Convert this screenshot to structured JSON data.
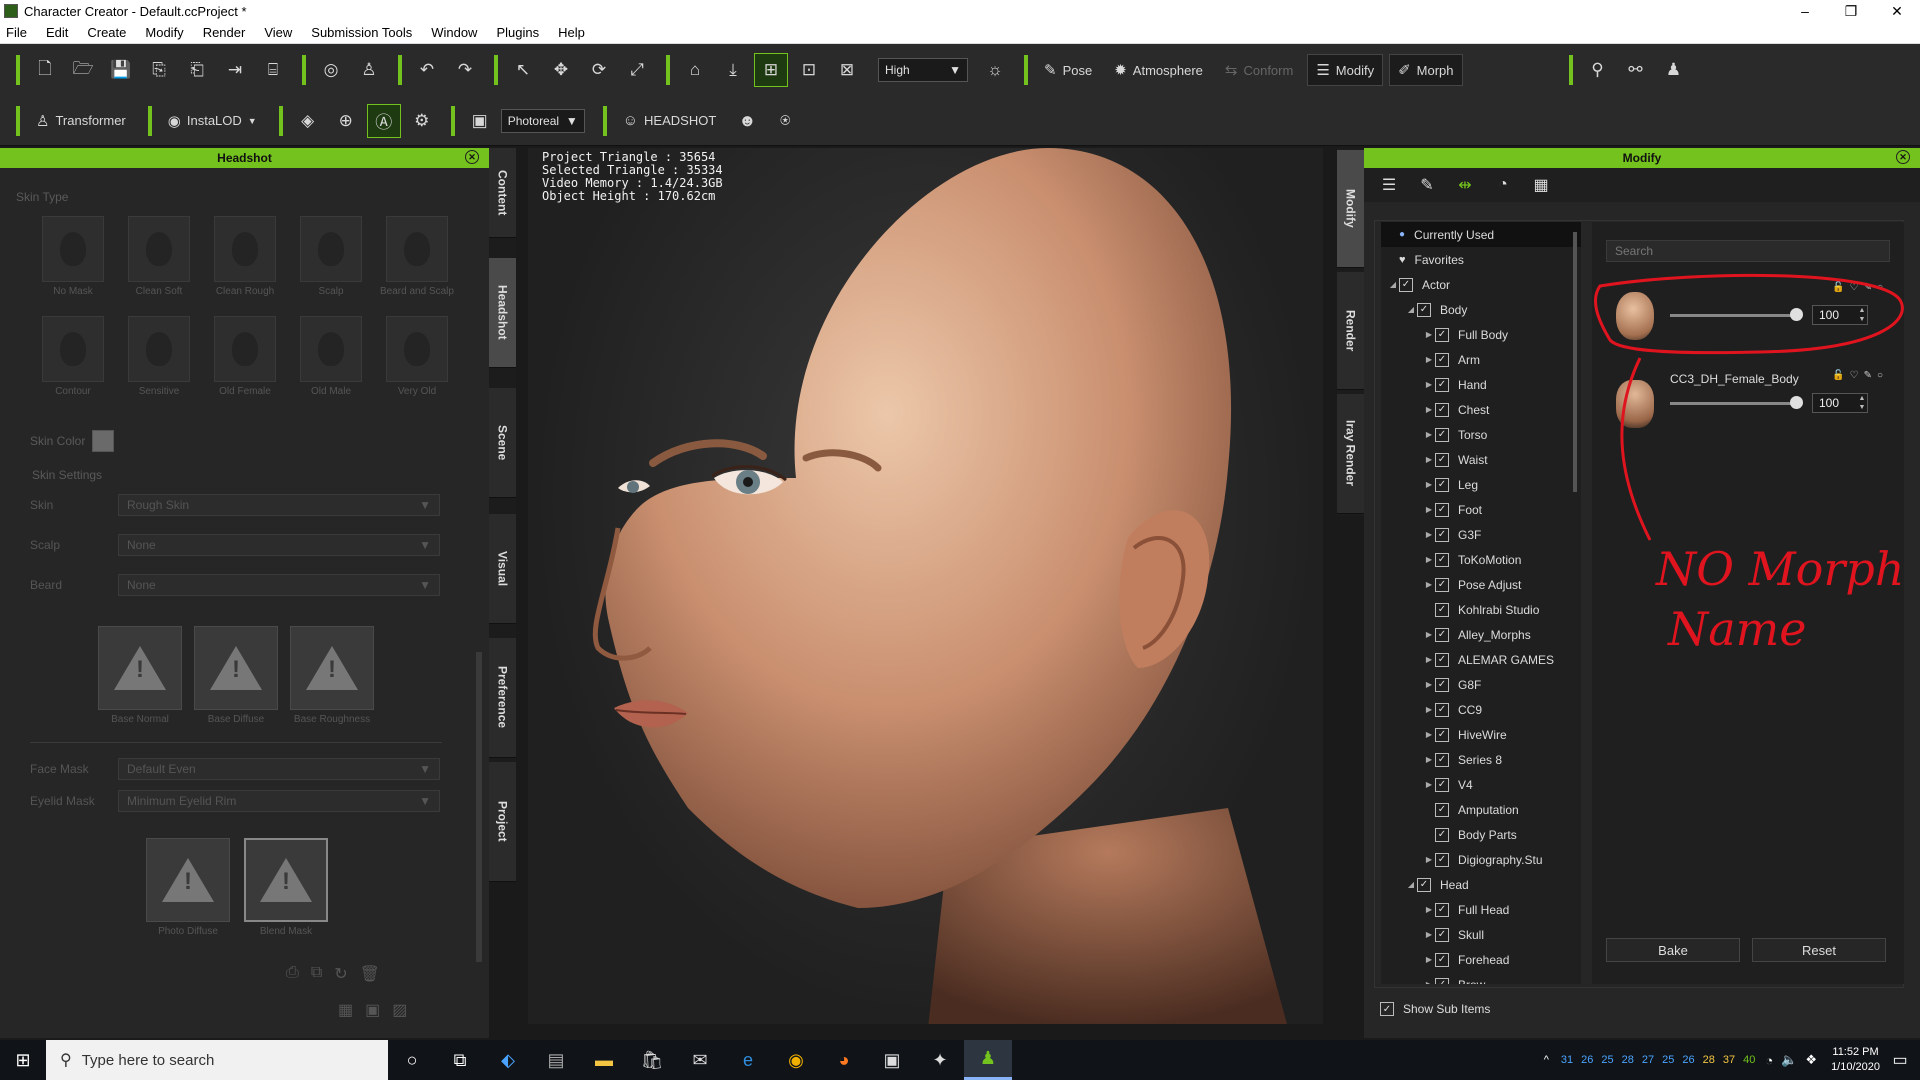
{
  "window": {
    "title": "Character Creator - Default.ccProject *",
    "controls": [
      "–",
      "❐",
      "✕"
    ]
  },
  "menu": [
    "File",
    "Edit",
    "Create",
    "Modify",
    "Render",
    "View",
    "Submission Tools",
    "Window",
    "Plugins",
    "Help"
  ],
  "toolbar": {
    "quality": "High",
    "pose_label": "Pose",
    "atmosphere_label": "Atmosphere",
    "conform_label": "Conform",
    "modify_label": "Modify",
    "morph_label": "Morph",
    "transformer_label": "Transformer",
    "instalod_label": "InstaLOD",
    "render_mode": "Photoreal",
    "headshot_label": "HEADSHOT"
  },
  "left_panel": {
    "title": "Headshot",
    "skin_type_label": "Skin Type",
    "skin_types": [
      "No Mask",
      "Clean Soft",
      "Clean Rough",
      "Scalp",
      "Beard and Scalp",
      "Contour",
      "Sensitive",
      "Old Female",
      "Old Male",
      "Very Old"
    ],
    "skin_color_label": "Skin Color",
    "skin_color": "#6a6a6a",
    "skin_settings_label": "Skin Settings",
    "skin_label": "Skin",
    "skin_value": "Rough Skin",
    "scalp_label": "Scalp",
    "scalp_value": "None",
    "beard_label": "Beard",
    "beard_value": "None",
    "base_maps": [
      "Base Normal",
      "Base Diffuse",
      "Base Roughness"
    ],
    "face_mask_label": "Face Mask",
    "face_mask_value": "Default Even",
    "eyelid_mask_label": "Eyelid Mask",
    "eyelid_mask_value": "Minimum Eyelid Rim",
    "photo_maps": [
      "Photo Diffuse",
      "Blend Mask"
    ]
  },
  "left_tabs": [
    "Content",
    "Headshot",
    "Scene",
    "Visual",
    "Preference",
    "Project"
  ],
  "viewport": {
    "project_triangle": "Project Triangle : 35654",
    "selected_triangle": "Selected Triangle : 35334",
    "video_memory": "Video Memory : 1.4/24.3GB",
    "object_height": "Object Height : 170.62cm",
    "annotation": "NO Morph Name"
  },
  "right_tabs": [
    "Modify",
    "Render",
    "Iray Render"
  ],
  "right_panel": {
    "title": "Modify",
    "tree": [
      {
        "label": "Currently Used",
        "level": 0,
        "type": "dot"
      },
      {
        "label": "Favorites",
        "level": 0,
        "type": "heart"
      },
      {
        "label": "Actor",
        "level": 0,
        "arrow": "◢",
        "check": true
      },
      {
        "label": "Body",
        "level": 1,
        "arrow": "◢",
        "check": true
      },
      {
        "label": "Full Body",
        "level": 2,
        "arrow": "▶",
        "check": true
      },
      {
        "label": "Arm",
        "level": 2,
        "arrow": "▶",
        "check": true
      },
      {
        "label": "Hand",
        "level": 2,
        "arrow": "▶",
        "check": true
      },
      {
        "label": "Chest",
        "level": 2,
        "arrow": "▶",
        "check": true
      },
      {
        "label": "Torso",
        "level": 2,
        "arrow": "▶",
        "check": true
      },
      {
        "label": "Waist",
        "level": 2,
        "arrow": "▶",
        "check": true
      },
      {
        "label": "Leg",
        "level": 2,
        "arrow": "▶",
        "check": true
      },
      {
        "label": "Foot",
        "level": 2,
        "arrow": "▶",
        "check": true
      },
      {
        "label": "G3F",
        "level": 2,
        "arrow": "▶",
        "check": true
      },
      {
        "label": "ToKoMotion",
        "level": 2,
        "arrow": "▶",
        "check": true
      },
      {
        "label": "Pose Adjust",
        "level": 2,
        "arrow": "▶",
        "check": true
      },
      {
        "label": "Kohlrabi Studio",
        "level": 2,
        "arrow": "",
        "check": true
      },
      {
        "label": "Alley_Morphs",
        "level": 2,
        "arrow": "▶",
        "check": true
      },
      {
        "label": "ALEMAR GAMES",
        "level": 2,
        "arrow": "▶",
        "check": true
      },
      {
        "label": "G8F",
        "level": 2,
        "arrow": "▶",
        "check": true
      },
      {
        "label": "CC9",
        "level": 2,
        "arrow": "▶",
        "check": true
      },
      {
        "label": "HiveWire",
        "level": 2,
        "arrow": "▶",
        "check": true
      },
      {
        "label": "Series 8",
        "level": 2,
        "arrow": "▶",
        "check": true
      },
      {
        "label": "V4",
        "level": 2,
        "arrow": "▶",
        "check": true
      },
      {
        "label": "Amputation",
        "level": 2,
        "arrow": "",
        "check": true
      },
      {
        "label": "Body Parts",
        "level": 2,
        "arrow": "",
        "check": true
      },
      {
        "label": "Digiography.Stu",
        "level": 2,
        "arrow": "▶",
        "check": true
      },
      {
        "label": "Head",
        "level": 1,
        "arrow": "◢",
        "check": true
      },
      {
        "label": "Full Head",
        "level": 2,
        "arrow": "▶",
        "check": true
      },
      {
        "label": "Skull",
        "level": 2,
        "arrow": "▶",
        "check": true
      },
      {
        "label": "Forehead",
        "level": 2,
        "arrow": "▶",
        "check": true
      },
      {
        "label": "Brow",
        "level": 2,
        "arrow": "▶",
        "check": true
      }
    ],
    "search_placeholder": "Search",
    "morphs": [
      {
        "name": "",
        "value": "100"
      },
      {
        "name": "CC3_DH_Female_Body",
        "value": "100"
      }
    ],
    "bake_label": "Bake",
    "reset_label": "Reset",
    "show_sub_items_label": "Show Sub Items"
  },
  "taskbar": {
    "search_placeholder": "Type here to search",
    "tray_numbers": [
      "31",
      "26",
      "25",
      "28",
      "27",
      "25",
      "26",
      "28",
      "37",
      "40"
    ],
    "time": "11:52 PM",
    "date": "1/10/2020"
  },
  "colors": {
    "accent": "#74c21d",
    "annotation": "#e0141e"
  }
}
